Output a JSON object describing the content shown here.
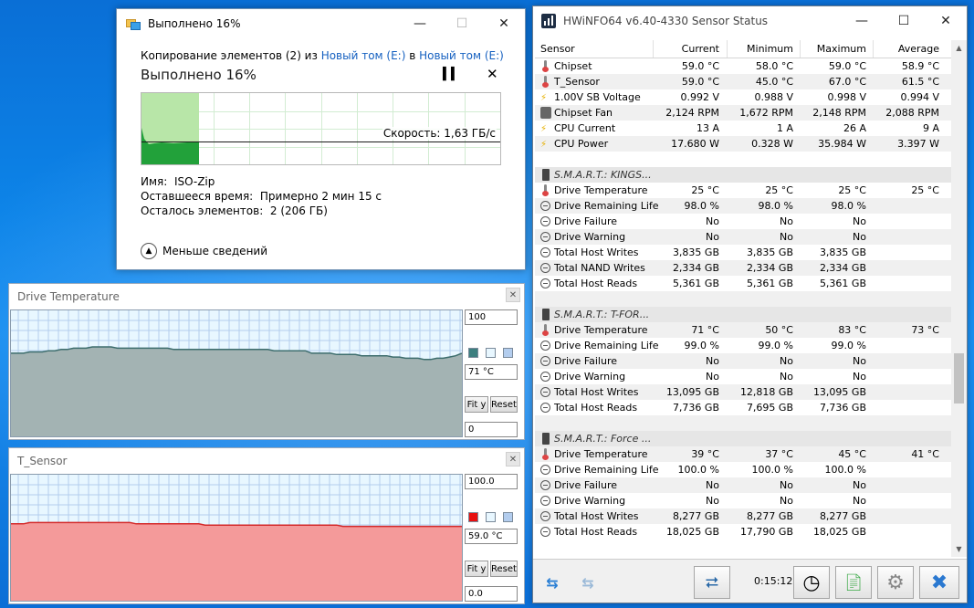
{
  "copy_dialog": {
    "title": "Выполнено 16%",
    "line_prefix": "Копирование элементов (2) из ",
    "source": "Новый том (E:)",
    "line_middle": " в ",
    "destination": "Новый том (E:)",
    "heading": "Выполнено 16%",
    "progress_fraction": 0.16,
    "speed": "Скорость: 1,63 ГБ/с",
    "name_label": "Имя:",
    "name_value": "ISO-Zip",
    "time_label": "Оставшееся время:",
    "time_value": "Примерно 2 мин 15 с",
    "items_label": "Осталось элементов:",
    "items_value": "2 (206 ГБ)",
    "less_details": "Меньше сведений",
    "colors": {
      "progress": "#b8e6a8",
      "throughput": "#22a13a",
      "link": "#1560c0"
    }
  },
  "graph_drive_temp": {
    "title": "Drive Temperature",
    "max": "100",
    "current": "71 °C",
    "min": "0",
    "fit_label": "Fit y",
    "reset_label": "Reset",
    "colors": {
      "fill": "#a3b3b3",
      "line": "#3d6d6d",
      "swatch": "#3d7f7f"
    },
    "series": [
      66,
      66,
      66,
      67,
      67,
      67,
      68,
      68,
      69,
      69,
      70,
      70,
      70,
      71,
      71,
      71,
      71,
      70,
      70,
      70,
      70,
      70,
      70,
      70,
      70,
      70,
      69,
      69,
      69,
      69,
      69,
      69,
      69,
      69,
      69,
      69,
      69,
      69,
      69,
      69,
      69,
      69,
      68,
      68,
      68,
      68,
      68,
      68,
      66,
      66,
      66,
      66,
      65,
      65,
      65,
      65,
      64,
      64,
      64,
      64,
      64,
      63,
      63,
      62,
      62,
      62,
      61,
      61,
      62,
      62,
      63,
      64,
      66
    ]
  },
  "graph_t_sensor": {
    "title": "T_Sensor",
    "max": "100.0",
    "current": "59.0 °C",
    "min": "0.0",
    "fit_label": "Fit y",
    "reset_label": "Reset",
    "colors": {
      "fill": "#f49a9a",
      "line": "#d42a2a",
      "swatch": "#e81010"
    },
    "series": [
      61,
      61,
      61,
      62,
      62,
      62,
      62,
      62,
      62,
      62,
      62,
      62,
      62,
      62,
      62,
      62,
      62,
      62,
      62,
      62,
      61,
      61,
      61,
      61,
      61,
      61,
      61,
      61,
      61,
      61,
      61,
      60,
      60,
      60,
      60,
      60,
      60,
      60,
      60,
      60,
      60,
      60,
      60,
      60,
      60,
      60,
      60,
      60,
      60,
      60,
      60,
      60,
      60,
      59,
      59,
      59,
      59,
      59,
      59,
      59,
      59,
      59,
      59,
      59,
      59,
      59,
      59,
      59,
      59,
      59,
      59,
      59,
      59
    ]
  },
  "hwinfo": {
    "title": "HWiNFO64 v6.40-4330 Sensor Status",
    "columns": [
      "Sensor",
      "Current",
      "Minimum",
      "Maximum",
      "Average"
    ],
    "rows": [
      {
        "icon": "therm",
        "name": "Chipset",
        "cur": "59.0 °C",
        "min": "58.0 °C",
        "max": "59.0 °C",
        "avg": "58.9 °C"
      },
      {
        "icon": "therm",
        "name": "T_Sensor",
        "cur": "59.0 °C",
        "min": "45.0 °C",
        "max": "67.0 °C",
        "avg": "61.5 °C"
      },
      {
        "icon": "bolt",
        "name": "1.00V SB Voltage",
        "cur": "0.992 V",
        "min": "0.988 V",
        "max": "0.998 V",
        "avg": "0.994 V"
      },
      {
        "icon": "fan",
        "name": "Chipset Fan",
        "cur": "2,124 RPM",
        "min": "1,672 RPM",
        "max": "2,148 RPM",
        "avg": "2,088 RPM"
      },
      {
        "icon": "bolt",
        "name": "CPU Current",
        "cur": "13 A",
        "min": "1 A",
        "max": "26 A",
        "avg": "9 A"
      },
      {
        "icon": "bolt",
        "name": "CPU Power",
        "cur": "17.680 W",
        "min": "0.328 W",
        "max": "35.984 W",
        "avg": "3.397 W"
      },
      {
        "icon": "none",
        "name": "",
        "cur": "",
        "min": "",
        "max": "",
        "avg": ""
      },
      {
        "icon": "disk",
        "name": "S.M.A.R.T.: KINGS...",
        "group": true,
        "cur": "",
        "min": "",
        "max": "",
        "avg": ""
      },
      {
        "icon": "therm",
        "name": "Drive Temperature",
        "cur": "25 °C",
        "min": "25 °C",
        "max": "25 °C",
        "avg": "25 °C"
      },
      {
        "icon": "clock",
        "name": "Drive Remaining Life",
        "cur": "98.0 %",
        "min": "98.0 %",
        "max": "98.0 %",
        "avg": ""
      },
      {
        "icon": "clock",
        "name": "Drive Failure",
        "cur": "No",
        "min": "No",
        "max": "No",
        "avg": ""
      },
      {
        "icon": "clock",
        "name": "Drive Warning",
        "cur": "No",
        "min": "No",
        "max": "No",
        "avg": ""
      },
      {
        "icon": "clock",
        "name": "Total Host Writes",
        "cur": "3,835 GB",
        "min": "3,835 GB",
        "max": "3,835 GB",
        "avg": ""
      },
      {
        "icon": "clock",
        "name": "Total NAND Writes",
        "cur": "2,334 GB",
        "min": "2,334 GB",
        "max": "2,334 GB",
        "avg": ""
      },
      {
        "icon": "clock",
        "name": "Total Host Reads",
        "cur": "5,361 GB",
        "min": "5,361 GB",
        "max": "5,361 GB",
        "avg": ""
      },
      {
        "icon": "none",
        "name": "",
        "cur": "",
        "min": "",
        "max": "",
        "avg": ""
      },
      {
        "icon": "disk",
        "name": "S.M.A.R.T.: T-FOR...",
        "group": true,
        "cur": "",
        "min": "",
        "max": "",
        "avg": ""
      },
      {
        "icon": "therm",
        "name": "Drive Temperature",
        "cur": "71 °C",
        "min": "50 °C",
        "max": "83 °C",
        "avg": "73 °C"
      },
      {
        "icon": "clock",
        "name": "Drive Remaining Life",
        "cur": "99.0 %",
        "min": "99.0 %",
        "max": "99.0 %",
        "avg": ""
      },
      {
        "icon": "clock",
        "name": "Drive Failure",
        "cur": "No",
        "min": "No",
        "max": "No",
        "avg": ""
      },
      {
        "icon": "clock",
        "name": "Drive Warning",
        "cur": "No",
        "min": "No",
        "max": "No",
        "avg": ""
      },
      {
        "icon": "clock",
        "name": "Total Host Writes",
        "cur": "13,095 GB",
        "min": "12,818 GB",
        "max": "13,095 GB",
        "avg": ""
      },
      {
        "icon": "clock",
        "name": "Total Host Reads",
        "cur": "7,736 GB",
        "min": "7,695 GB",
        "max": "7,736 GB",
        "avg": ""
      },
      {
        "icon": "none",
        "name": "",
        "cur": "",
        "min": "",
        "max": "",
        "avg": ""
      },
      {
        "icon": "disk",
        "name": "S.M.A.R.T.: Force ...",
        "group": true,
        "cur": "",
        "min": "",
        "max": "",
        "avg": ""
      },
      {
        "icon": "therm",
        "name": "Drive Temperature",
        "cur": "39 °C",
        "min": "37 °C",
        "max": "45 °C",
        "avg": "41 °C"
      },
      {
        "icon": "clock",
        "name": "Drive Remaining Life",
        "cur": "100.0 %",
        "min": "100.0 %",
        "max": "100.0 %",
        "avg": ""
      },
      {
        "icon": "clock",
        "name": "Drive Failure",
        "cur": "No",
        "min": "No",
        "max": "No",
        "avg": ""
      },
      {
        "icon": "clock",
        "name": "Drive Warning",
        "cur": "No",
        "min": "No",
        "max": "No",
        "avg": ""
      },
      {
        "icon": "clock",
        "name": "Total Host Writes",
        "cur": "8,277 GB",
        "min": "8,277 GB",
        "max": "8,277 GB",
        "avg": ""
      },
      {
        "icon": "clock",
        "name": "Total Host Reads",
        "cur": "18,025 GB",
        "min": "17,790 GB",
        "max": "18,025 GB",
        "avg": ""
      }
    ],
    "elapsed": "0:15:12",
    "icons": [
      "nav-arrows-icon",
      "nav-arrows-disabled-icon",
      "network-icon",
      "clock-icon",
      "add-report-icon",
      "settings-gear-icon",
      "close-x-icon"
    ]
  }
}
